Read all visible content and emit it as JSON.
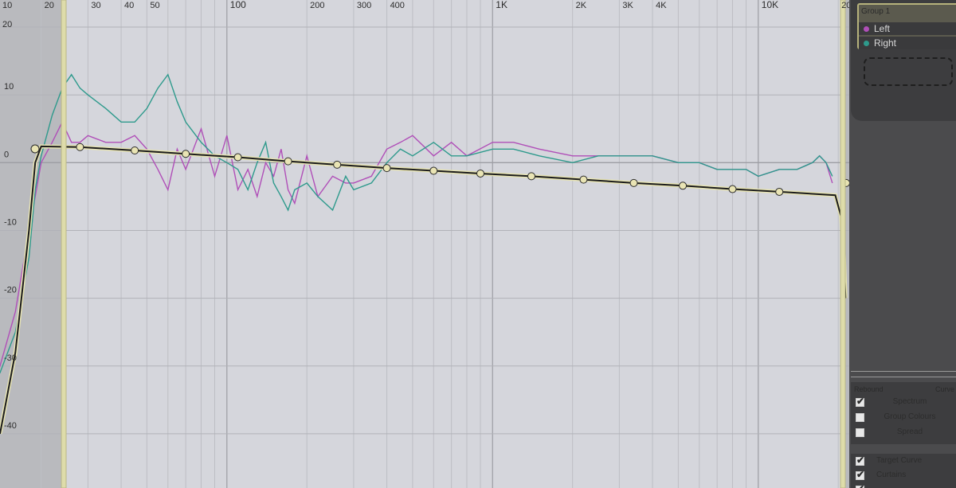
{
  "plot": {
    "x_ticks": [
      {
        "label": "20",
        "f": 20
      },
      {
        "label": "30",
        "f": 30
      },
      {
        "label": "40",
        "f": 40
      },
      {
        "label": "50",
        "f": 50
      },
      {
        "label": "100",
        "f": 100
      },
      {
        "label": "200",
        "f": 200
      },
      {
        "label": "300",
        "f": 300
      },
      {
        "label": "400",
        "f": 400
      },
      {
        "label": "1K",
        "f": 1000
      },
      {
        "label": "2K",
        "f": 2000
      },
      {
        "label": "3K",
        "f": 3000
      },
      {
        "label": "4K",
        "f": 4000
      },
      {
        "label": "10K",
        "f": 10000
      },
      {
        "label": "20K",
        "f": 20000
      }
    ],
    "y_ticks": [
      "10",
      "0",
      "-10",
      "-20",
      "-30",
      "-40"
    ],
    "top_left_label": "10",
    "y_top_label": "20",
    "colors": {
      "left": "#b04fb8",
      "right": "#2e9a8c",
      "target": "#1c1c1c",
      "target_outline": "#e6e3b4",
      "node": "#e9e4b4"
    }
  },
  "chart_data": {
    "type": "line",
    "x_scale": "log",
    "xlim": [
      14,
      22000
    ],
    "ylim": [
      -48,
      24
    ],
    "series": [
      {
        "name": "Left",
        "points": [
          [
            10,
            -40
          ],
          [
            12,
            -36
          ],
          [
            14,
            -30
          ],
          [
            16,
            -22
          ],
          [
            18,
            -10
          ],
          [
            19,
            -5
          ],
          [
            20,
            0
          ],
          [
            22,
            3
          ],
          [
            24,
            6
          ],
          [
            26,
            3
          ],
          [
            28,
            3
          ],
          [
            30,
            4
          ],
          [
            35,
            3
          ],
          [
            40,
            3
          ],
          [
            45,
            4
          ],
          [
            50,
            2
          ],
          [
            55,
            -1
          ],
          [
            60,
            -4
          ],
          [
            65,
            2
          ],
          [
            70,
            -1
          ],
          [
            80,
            5
          ],
          [
            90,
            -2
          ],
          [
            100,
            4
          ],
          [
            110,
            -4
          ],
          [
            120,
            -1
          ],
          [
            130,
            -5
          ],
          [
            140,
            0
          ],
          [
            150,
            -2
          ],
          [
            160,
            2
          ],
          [
            170,
            -4
          ],
          [
            180,
            -6
          ],
          [
            200,
            1
          ],
          [
            220,
            -5
          ],
          [
            250,
            -2
          ],
          [
            280,
            -3
          ],
          [
            300,
            -3
          ],
          [
            350,
            -2
          ],
          [
            400,
            2
          ],
          [
            450,
            3
          ],
          [
            500,
            4
          ],
          [
            600,
            1
          ],
          [
            700,
            3
          ],
          [
            800,
            1
          ],
          [
            1000,
            3
          ],
          [
            1200,
            3
          ],
          [
            1500,
            2
          ],
          [
            2000,
            1
          ],
          [
            2500,
            1
          ],
          [
            3000,
            1
          ],
          [
            3500,
            1
          ],
          [
            4000,
            1
          ],
          [
            5000,
            0
          ],
          [
            6000,
            0
          ],
          [
            7000,
            -1
          ],
          [
            8000,
            -1
          ],
          [
            9000,
            -1
          ],
          [
            10000,
            -2
          ],
          [
            12000,
            -1
          ],
          [
            14000,
            -1
          ],
          [
            16000,
            0
          ],
          [
            17000,
            1
          ],
          [
            18000,
            0
          ],
          [
            19000,
            -3
          ]
        ]
      },
      {
        "name": "Right",
        "points": [
          [
            10,
            -38
          ],
          [
            12,
            -34
          ],
          [
            14,
            -31
          ],
          [
            16,
            -25
          ],
          [
            18,
            -14
          ],
          [
            19,
            -4
          ],
          [
            20,
            1
          ],
          [
            22,
            7
          ],
          [
            24,
            11
          ],
          [
            26,
            13
          ],
          [
            28,
            11
          ],
          [
            30,
            10
          ],
          [
            35,
            8
          ],
          [
            40,
            6
          ],
          [
            45,
            6
          ],
          [
            50,
            8
          ],
          [
            55,
            11
          ],
          [
            60,
            13
          ],
          [
            65,
            9
          ],
          [
            70,
            6
          ],
          [
            80,
            3
          ],
          [
            90,
            1
          ],
          [
            100,
            0
          ],
          [
            110,
            -1
          ],
          [
            120,
            -4
          ],
          [
            130,
            0
          ],
          [
            140,
            3
          ],
          [
            150,
            -3
          ],
          [
            160,
            -5
          ],
          [
            170,
            -7
          ],
          [
            180,
            -4
          ],
          [
            200,
            -3
          ],
          [
            220,
            -5
          ],
          [
            250,
            -7
          ],
          [
            280,
            -2
          ],
          [
            300,
            -4
          ],
          [
            350,
            -3
          ],
          [
            400,
            0
          ],
          [
            450,
            2
          ],
          [
            500,
            1
          ],
          [
            600,
            3
          ],
          [
            700,
            1
          ],
          [
            800,
            1
          ],
          [
            1000,
            2
          ],
          [
            1200,
            2
          ],
          [
            1500,
            1
          ],
          [
            2000,
            0
          ],
          [
            2500,
            1
          ],
          [
            3000,
            1
          ],
          [
            3500,
            1
          ],
          [
            4000,
            1
          ],
          [
            5000,
            0
          ],
          [
            6000,
            0
          ],
          [
            7000,
            -1
          ],
          [
            8000,
            -1
          ],
          [
            9000,
            -1
          ],
          [
            10000,
            -2
          ],
          [
            12000,
            -1
          ],
          [
            14000,
            -1
          ],
          [
            16000,
            0
          ],
          [
            17000,
            1
          ],
          [
            18000,
            0
          ],
          [
            19000,
            -2
          ]
        ]
      },
      {
        "name": "Target",
        "points": [
          [
            14,
            -40
          ],
          [
            16,
            -28
          ],
          [
            18,
            -10
          ],
          [
            19,
            0
          ],
          [
            20,
            2.4
          ],
          [
            28,
            2.3
          ],
          [
            45,
            1.8
          ],
          [
            70,
            1.3
          ],
          [
            110,
            0.8
          ],
          [
            170,
            0.2
          ],
          [
            260,
            -0.3
          ],
          [
            400,
            -0.8
          ],
          [
            600,
            -1.2
          ],
          [
            900,
            -1.6
          ],
          [
            1400,
            -2.0
          ],
          [
            2200,
            -2.5
          ],
          [
            3400,
            -3.0
          ],
          [
            5200,
            -3.4
          ],
          [
            8000,
            -3.9
          ],
          [
            12000,
            -4.3
          ],
          [
            19500,
            -4.8
          ],
          [
            20500,
            -8
          ],
          [
            21000,
            -14
          ],
          [
            21300,
            -20
          ]
        ]
      }
    ],
    "nodes": [
      [
        28,
        2.3
      ],
      [
        45,
        1.8
      ],
      [
        70,
        1.3
      ],
      [
        110,
        0.8
      ],
      [
        170,
        0.2
      ],
      [
        260,
        -0.3
      ],
      [
        400,
        -0.8
      ],
      [
        600,
        -1.2
      ],
      [
        900,
        -1.6
      ],
      [
        1400,
        -2.0
      ],
      [
        2200,
        -2.5
      ],
      [
        3400,
        -3.0
      ],
      [
        5200,
        -3.4
      ],
      [
        8000,
        -3.9
      ],
      [
        12000,
        -4.3
      ],
      [
        21500,
        -3.0
      ]
    ]
  },
  "sidebar": {
    "group_title": "Group 1",
    "channels": [
      {
        "label": "Left",
        "color": "#b04fb8"
      },
      {
        "label": "Right",
        "color": "#2e9a8c"
      }
    ],
    "options_head_left": "Rebound",
    "options_head_right": "Curve",
    "options": [
      {
        "label": "Spectrum",
        "checked": true
      },
      {
        "label": "Group Colours",
        "checked": false
      },
      {
        "label": "Spread",
        "checked": false
      }
    ],
    "options2": [
      {
        "label": "Target Curve",
        "checked": true
      },
      {
        "label": "Curtains",
        "checked": true
      },
      {
        "label": "",
        "checked": true
      }
    ]
  }
}
